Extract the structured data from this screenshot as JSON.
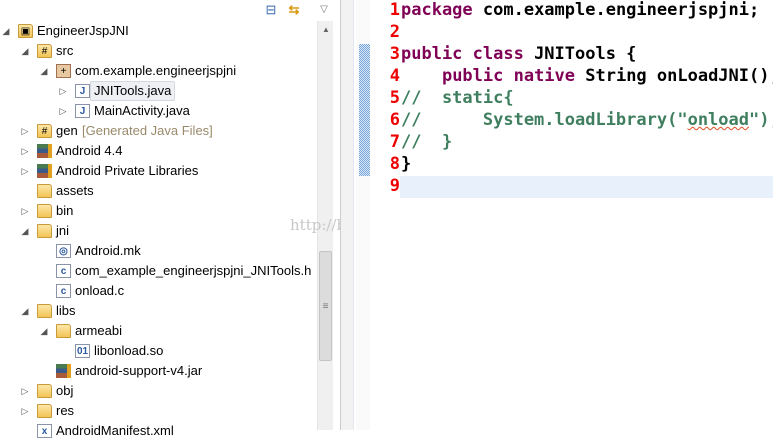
{
  "explorer": {
    "toolbar": {
      "collapse_icon": "collapse-all-icon",
      "link_icon": "link-with-editor-icon",
      "menu_icon": "view-menu-icon"
    },
    "items": [
      {
        "label": "EngineerJspJNI",
        "level": 0,
        "state": "expanded",
        "icon": "project"
      },
      {
        "label": "src",
        "level": 1,
        "state": "expanded",
        "icon": "src-folder"
      },
      {
        "label": "com.example.engineerjspjni",
        "level": 2,
        "state": "expanded",
        "icon": "package"
      },
      {
        "label": "JNITools.java",
        "level": 3,
        "state": "collapsed",
        "icon": "java",
        "selected": true
      },
      {
        "label": "MainActivity.java",
        "level": 3,
        "state": "collapsed",
        "icon": "java"
      },
      {
        "label": "gen",
        "decoration": "[Generated Java Files]",
        "level": 1,
        "state": "collapsed",
        "icon": "src-folder"
      },
      {
        "label": "Android 4.4",
        "level": 1,
        "state": "collapsed",
        "icon": "library"
      },
      {
        "label": "Android Private Libraries",
        "level": 1,
        "state": "collapsed",
        "icon": "library"
      },
      {
        "label": "assets",
        "level": 1,
        "state": "none",
        "icon": "folder"
      },
      {
        "label": "bin",
        "level": 1,
        "state": "collapsed",
        "icon": "folder"
      },
      {
        "label": "jni",
        "level": 1,
        "state": "expanded",
        "icon": "folder"
      },
      {
        "label": "Android.mk",
        "level": 2,
        "state": "none",
        "icon": "mk"
      },
      {
        "label": "com_example_engineerjspjni_JNITools.h",
        "level": 2,
        "state": "none",
        "icon": "c"
      },
      {
        "label": "onload.c",
        "level": 2,
        "state": "none",
        "icon": "c"
      },
      {
        "label": "libs",
        "level": 1,
        "state": "expanded",
        "icon": "folder"
      },
      {
        "label": "armeabi",
        "level": 2,
        "state": "expanded",
        "icon": "folder"
      },
      {
        "label": "libonload.so",
        "level": 3,
        "state": "none",
        "icon": "binary"
      },
      {
        "label": "android-support-v4.jar",
        "level": 2,
        "state": "none",
        "icon": "jar"
      },
      {
        "label": "obj",
        "level": 1,
        "state": "collapsed",
        "icon": "folder"
      },
      {
        "label": "res",
        "level": 1,
        "state": "collapsed",
        "icon": "folder"
      },
      {
        "label": "AndroidManifest.xml",
        "level": 1,
        "state": "none",
        "icon": "xml"
      }
    ]
  },
  "editor": {
    "line_numbers": [
      "1",
      "2",
      "3",
      "4",
      "5",
      "6",
      "7",
      "8",
      "9"
    ],
    "lines": [
      [
        {
          "t": "package",
          "c": "kw"
        },
        {
          "t": " com.example.engineerjspjni;"
        }
      ],
      [],
      [
        {
          "t": "public class",
          "c": "kw"
        },
        {
          "t": " JNITools {"
        }
      ],
      [
        {
          "t": "    "
        },
        {
          "t": "public native",
          "c": "kw"
        },
        {
          "t": " String onLoadJNI();"
        }
      ],
      [
        {
          "t": "//  static{",
          "c": "cm"
        }
      ],
      [
        {
          "t": "//      System.loadLibrary(\"",
          "c": "cm"
        },
        {
          "t": "onload",
          "c": "cm squig"
        },
        {
          "t": "\");",
          "c": "cm"
        }
      ],
      [
        {
          "t": "//  }",
          "c": "cm"
        }
      ],
      [
        {
          "t": "}"
        }
      ],
      []
    ],
    "current_line": 9
  },
  "watermark": "http://blog.csdn.net/"
}
